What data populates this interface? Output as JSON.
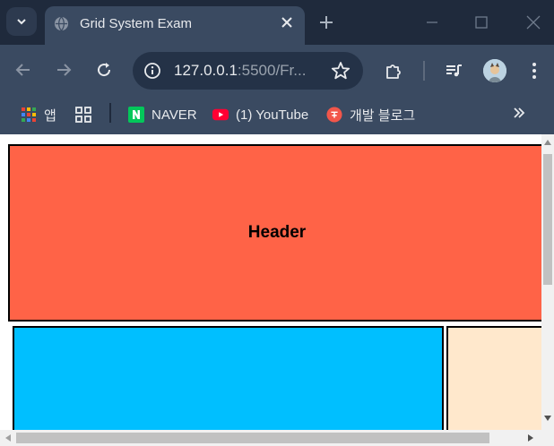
{
  "browser": {
    "tab_title": "Grid System Exam",
    "url_host": "127.0.0.1",
    "url_rest": ":5500/Fr...",
    "bookmarks": [
      {
        "label": "앱",
        "icon": "apps-grid-icon"
      },
      {
        "label": "",
        "icon": "tab-groups-icon"
      },
      {
        "label": "NAVER",
        "icon": "naver-icon"
      },
      {
        "label": "(1) YouTube",
        "icon": "youtube-icon"
      },
      {
        "label": "개발 블로그",
        "icon": "blog-icon"
      }
    ]
  },
  "page": {
    "header_label": "Header"
  },
  "colors": {
    "header": "#ff6347",
    "main": "#00bfff",
    "aside": "#ffe8cc",
    "chrome_dark": "#1f2a3c",
    "chrome_mid": "#3a4a61"
  }
}
